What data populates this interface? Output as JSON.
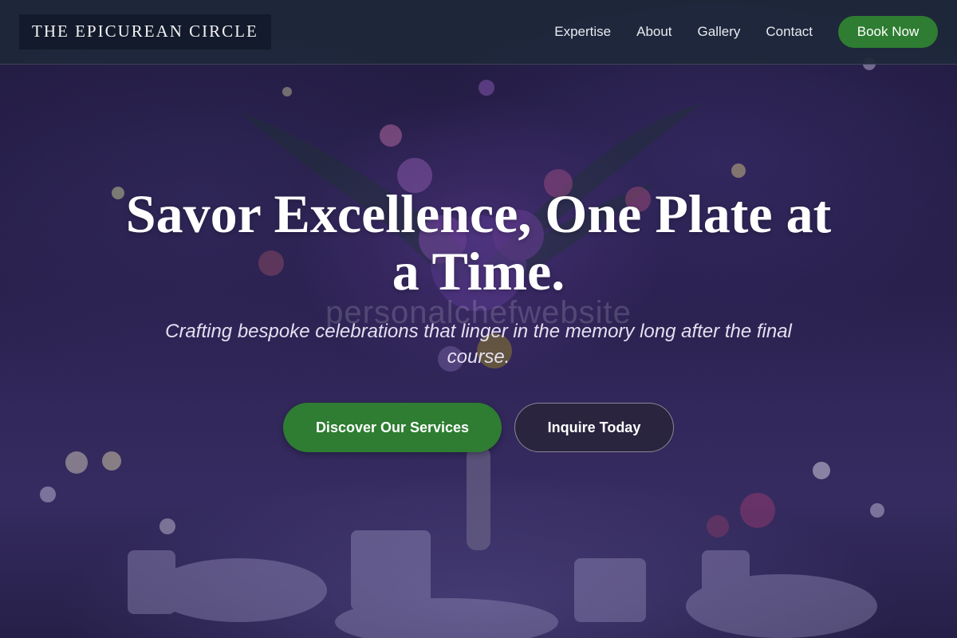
{
  "header": {
    "logo": "THE EPICUREAN CIRCLE",
    "nav": [
      "Expertise",
      "About",
      "Gallery",
      "Contact"
    ],
    "cta": "Book Now"
  },
  "hero": {
    "title": "Savor Excellence, One Plate at a Time.",
    "subtitle": "Crafting bespoke celebrations that linger in the memory long after the final course.",
    "primary_button": "Discover Our Services",
    "secondary_button": "Inquire Today",
    "watermark": "personalchefwebsite",
    "background_image": "floral-centerpiece-banquet-table"
  },
  "colors": {
    "header_bg": "#1e283a",
    "logo_bg": "#121a2b",
    "accent_green": "#2e7d32",
    "hero_tint": "#2b2150"
  }
}
